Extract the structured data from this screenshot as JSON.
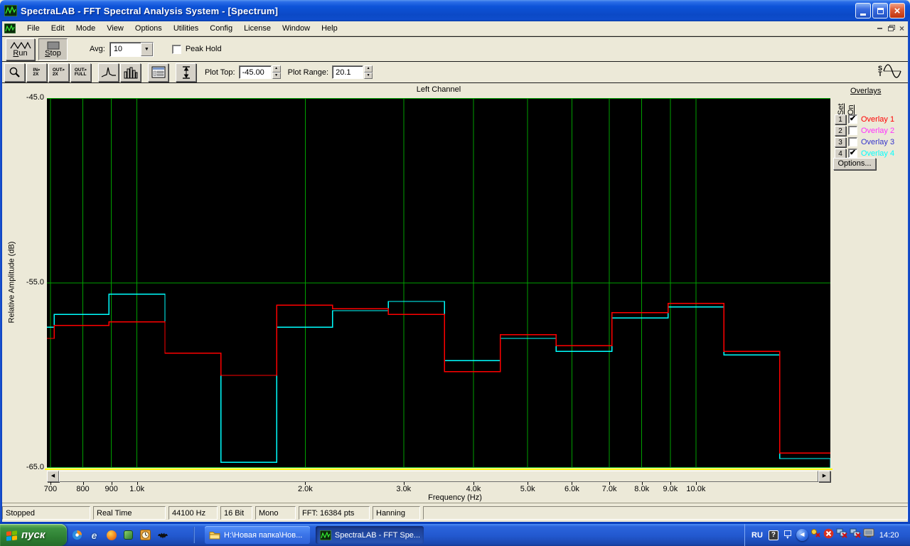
{
  "window": {
    "title": "SpectraLAB - FFT Spectral Analysis System - [Spectrum]",
    "controls": [
      "minimize",
      "maximize",
      "close"
    ],
    "mdi_controls": [
      "minimize-child",
      "restore-child",
      "close-child"
    ]
  },
  "menu": {
    "items": [
      "File",
      "Edit",
      "Mode",
      "View",
      "Options",
      "Utilities",
      "Config",
      "License",
      "Window",
      "Help"
    ]
  },
  "toolbar1": {
    "run_label": "Run",
    "stop_label": "Stop",
    "avg_label": "Avg:",
    "avg_value": "10",
    "peak_hold_label": "Peak Hold",
    "peak_hold_checked": false
  },
  "toolbar2": {
    "zoom_in_top": "IN",
    "zoom_in_bottom": "2X",
    "zoom_out_top": "OUT",
    "zoom_out_bottom": "2X",
    "zoom_full_top": "OUT",
    "zoom_full_bottom": "FULL",
    "plot_top_label": "Plot Top:",
    "plot_top_value": "-45.00",
    "plot_range_label": "Plot Range:",
    "plot_range_value": "20.1",
    "st_top": "S",
    "st_bottom": "T",
    "icons": [
      "magnifier-icon",
      "zoom-in-2x-icon",
      "zoom-out-2x-icon",
      "zoom-out-full-icon",
      "spectrum-curve-icon",
      "bar-display-icon",
      "display-options-icon",
      "vertical-scale-icon",
      "signal-generator-icon"
    ]
  },
  "overlays": {
    "title": "Overlays",
    "col_set": "Set",
    "col_on": "On",
    "options_label": "Options...",
    "items": [
      {
        "num": "1",
        "label": "Overlay 1",
        "color": "#FF0000",
        "on": true
      },
      {
        "num": "2",
        "label": "Overlay 2",
        "color": "#FF30FF",
        "on": false
      },
      {
        "num": "3",
        "label": "Overlay 3",
        "color": "#3434CC",
        "on": false
      },
      {
        "num": "4",
        "label": "Overlay 4",
        "color": "#00FFFF",
        "on": true
      }
    ]
  },
  "status_bar": {
    "panels": [
      "Stopped",
      "Real Time",
      "44100 Hz",
      "16 Bit",
      "Mono",
      "FFT: 16384 pts",
      "Hanning"
    ]
  },
  "taskbar": {
    "start_label": "пуск",
    "quick_launch_icons": [
      "media-player-icon",
      "internet-explorer-icon",
      "browser-icon",
      "green-app-icon",
      "scheduler-icon",
      "bat-app-icon"
    ],
    "tasks": [
      {
        "label": "H:\\Новая папка\\Нов...",
        "icon": "folder-icon",
        "active": false
      },
      {
        "label": "SpectraLAB - FFT Spe...",
        "icon": "spectralab-icon",
        "active": true
      }
    ],
    "tray": {
      "lang": "RU",
      "time": "14:20",
      "icons": [
        "help-balloon-icon",
        "language-bar-icon",
        "show-hidden-icons-chevron",
        "key-alert-icon",
        "abort-icon",
        "network-disabled-icon",
        "network-disabled-icon",
        "display-settings-icon"
      ]
    }
  },
  "chart_data": {
    "type": "line",
    "step": true,
    "title": "Left Channel",
    "xlabel": "Frequency (Hz)",
    "ylabel": "Relative Amplitude (dB)",
    "x_scale": "log",
    "xlim_hz": [
      690,
      17400
    ],
    "ylim_db": [
      -65,
      -45
    ],
    "grid": true,
    "grid_color": "#00A000",
    "plot_bg": "#000000",
    "axis_line_color": "#FFFF00",
    "x_ticks": [
      {
        "hz": 700,
        "label": "700"
      },
      {
        "hz": 800,
        "label": "800"
      },
      {
        "hz": 900,
        "label": "900"
      },
      {
        "hz": 1000,
        "label": "1.0k"
      },
      {
        "hz": 2000,
        "label": "2.0k"
      },
      {
        "hz": 3000,
        "label": "3.0k"
      },
      {
        "hz": 4000,
        "label": "4.0k"
      },
      {
        "hz": 5000,
        "label": "5.0k"
      },
      {
        "hz": 6000,
        "label": "6.0k"
      },
      {
        "hz": 7000,
        "label": "7.0k"
      },
      {
        "hz": 8000,
        "label": "8.0k"
      },
      {
        "hz": 9000,
        "label": "9.0k"
      },
      {
        "hz": 10000,
        "label": "10.0k"
      }
    ],
    "y_ticks": [
      {
        "db": -45,
        "label": "-45.0"
      },
      {
        "db": -55,
        "label": "-55.0"
      },
      {
        "db": -65,
        "label": "-65.0"
      }
    ],
    "band_edges_hz": [
      690,
      711,
      891,
      1122,
      1413,
      1778,
      2239,
      2818,
      3548,
      4467,
      5623,
      7079,
      8913,
      11220,
      14130,
      17400
    ],
    "series": [
      {
        "name": "Overlay 1",
        "color": "#FF0000",
        "drop_at_end": false,
        "values_db": [
          -58.0,
          -57.3,
          -57.1,
          -58.8,
          -60.0,
          -56.2,
          -56.4,
          -56.7,
          -59.8,
          -57.8,
          -58.4,
          -56.6,
          -56.1,
          -58.7,
          -64.2
        ]
      },
      {
        "name": "Overlay 4",
        "color": "#00FFFF",
        "drop_at_end": true,
        "values_db": [
          -57.4,
          -56.7,
          -55.6,
          -58.8,
          -64.7,
          -57.4,
          -56.5,
          -56.0,
          -59.2,
          -58.0,
          -58.7,
          -56.9,
          -56.3,
          -58.9,
          -64.5
        ]
      }
    ]
  }
}
